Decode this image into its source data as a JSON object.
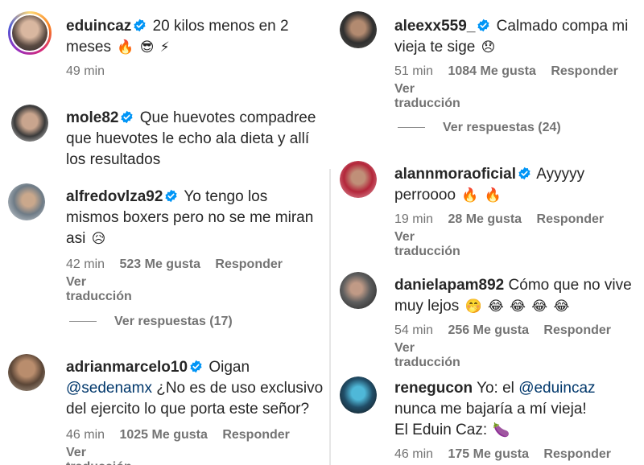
{
  "colors": {
    "text": "#262626",
    "secondary": "#737373",
    "verified": "#0095f6",
    "mention": "#00376b"
  },
  "left": [
    {
      "username": "eduincaz",
      "verified": true,
      "text": "20 kilos menos en 2 meses",
      "emojis": [
        "🔥",
        "😎",
        "⚡"
      ],
      "time": "49 min"
    },
    {
      "username": "mole82",
      "verified": true,
      "text": "Que huevotes compadree que huevotes le echo ala dieta y allí los resultados"
    },
    {
      "username": "alfredovlza92",
      "verified": true,
      "text": "Yo tengo los mismos boxers pero no se me miran asi",
      "emojis": [
        "😥"
      ],
      "time": "42 min",
      "likes": "523 Me gusta",
      "reply": "Responder",
      "translate": "Ver traducción",
      "view_replies": "Ver respuestas (17)"
    },
    {
      "username": "adrianmarcelo10",
      "verified": true,
      "text_before": "Oigan",
      "mention": "@sedenamx",
      "text_after": "¿No es de uso exclusivo del ejercito lo que porta este señor?",
      "time": "46 min",
      "likes": "1025 Me gusta",
      "reply": "Responder",
      "translate": "Ver traducción"
    }
  ],
  "right": [
    {
      "username": "aleexx559_",
      "verified": true,
      "text": "Calmado compa mi vieja te sige",
      "emojis": [
        "😞"
      ],
      "time": "51 min",
      "likes": "1084 Me gusta",
      "reply": "Responder",
      "translate": "Ver traducción",
      "view_replies": "Ver respuestas (24)"
    },
    {
      "username": "alannmoraoficial",
      "verified": true,
      "text": "Ayyyyy perroooo",
      "emojis": [
        "🔥",
        "🔥"
      ],
      "time": "19 min",
      "likes": "28 Me gusta",
      "reply": "Responder",
      "translate": "Ver traducción"
    },
    {
      "username": "danielapam892",
      "verified": false,
      "text": "Cómo que no vive muy lejos",
      "emojis": [
        "🤭",
        "😂",
        "😂",
        "😂",
        "😂"
      ],
      "time": "54 min",
      "likes": "256 Me gusta",
      "reply": "Responder",
      "translate": "Ver traducción"
    },
    {
      "username": "renegucon",
      "verified": false,
      "text_before": "Yo: el",
      "mention": "@eduincaz",
      "text_after": "nunca me bajaría a mí vieja!",
      "line2": "El Eduin Caz:",
      "emojis": [
        "🍆"
      ],
      "time": "46 min",
      "likes": "175 Me gusta",
      "reply": "Responder"
    }
  ]
}
